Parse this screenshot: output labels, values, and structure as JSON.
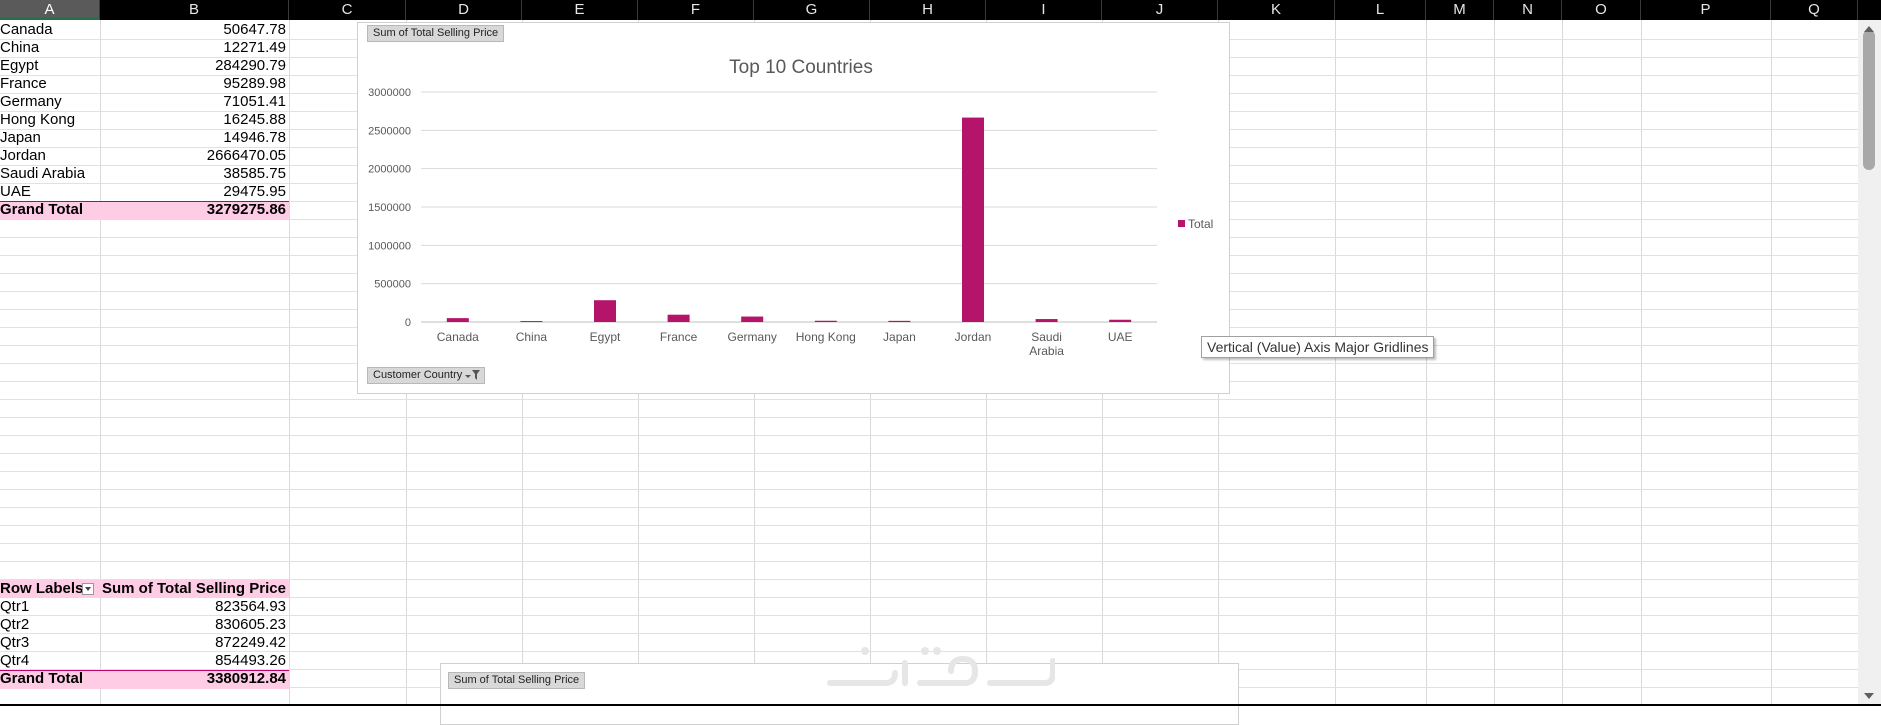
{
  "columns": [
    "A",
    "B",
    "C",
    "D",
    "E",
    "F",
    "G",
    "H",
    "I",
    "J",
    "K",
    "L",
    "M",
    "N",
    "O",
    "P",
    "Q"
  ],
  "selected_column": "A",
  "pivot1": {
    "rows": [
      {
        "label": "Canada",
        "value": "50647.78"
      },
      {
        "label": "China",
        "value": "12271.49"
      },
      {
        "label": "Egypt",
        "value": "284290.79"
      },
      {
        "label": "France",
        "value": "95289.98"
      },
      {
        "label": "Germany",
        "value": "71051.41"
      },
      {
        "label": "Hong Kong",
        "value": "16245.88"
      },
      {
        "label": "Japan",
        "value": "14946.78"
      },
      {
        "label": "Jordan",
        "value": "2666470.05"
      },
      {
        "label": "Saudi Arabia",
        "value": "38585.75"
      },
      {
        "label": "UAE",
        "value": "29475.95"
      }
    ],
    "total_label": "Grand Total",
    "total_value": "3279275.86"
  },
  "pivot2": {
    "header_label": "Row Labels",
    "header_value": "Sum of Total Selling Price",
    "rows": [
      {
        "label": "Qtr1",
        "value": "823564.93"
      },
      {
        "label": "Qtr2",
        "value": "830605.23"
      },
      {
        "label": "Qtr3",
        "value": "872249.42"
      },
      {
        "label": "Qtr4",
        "value": "854493.26"
      }
    ],
    "total_label": "Grand Total",
    "total_value": "3380912.84"
  },
  "chart1": {
    "field_button_top": "Sum of Total Selling Price",
    "field_button_bottom": "Customer Country",
    "tooltip": "Vertical (Value) Axis Major Gridlines"
  },
  "chart2": {
    "field_button_top": "Sum of Total Selling Price"
  },
  "colors": {
    "bar": "#b5146b",
    "total_row": "#ffcce6",
    "header_bg": "#000000"
  },
  "chart_data": {
    "type": "bar",
    "title": "Top 10 Countries",
    "categories": [
      "Canada",
      "China",
      "Egypt",
      "France",
      "Germany",
      "Hong Kong",
      "Japan",
      "Jordan",
      "Saudi Arabia",
      "UAE"
    ],
    "tick_labels": [
      [
        "Canada"
      ],
      [
        "China"
      ],
      [
        "Egypt"
      ],
      [
        "France"
      ],
      [
        "Germany"
      ],
      [
        "Hong Kong"
      ],
      [
        "Japan"
      ],
      [
        "Jordan"
      ],
      [
        "Saudi",
        "Arabia"
      ],
      [
        "UAE"
      ]
    ],
    "series": [
      {
        "name": "Total",
        "values": [
          50647.78,
          12271.49,
          284290.79,
          95289.98,
          71051.41,
          16245.88,
          14946.78,
          2666470.05,
          38585.75,
          29475.95
        ]
      }
    ],
    "yticks": [
      "0",
      "500000",
      "1000000",
      "1500000",
      "2000000",
      "2500000",
      "3000000"
    ],
    "ylim": [
      0,
      3000000
    ],
    "grid": true,
    "legend": "right"
  }
}
